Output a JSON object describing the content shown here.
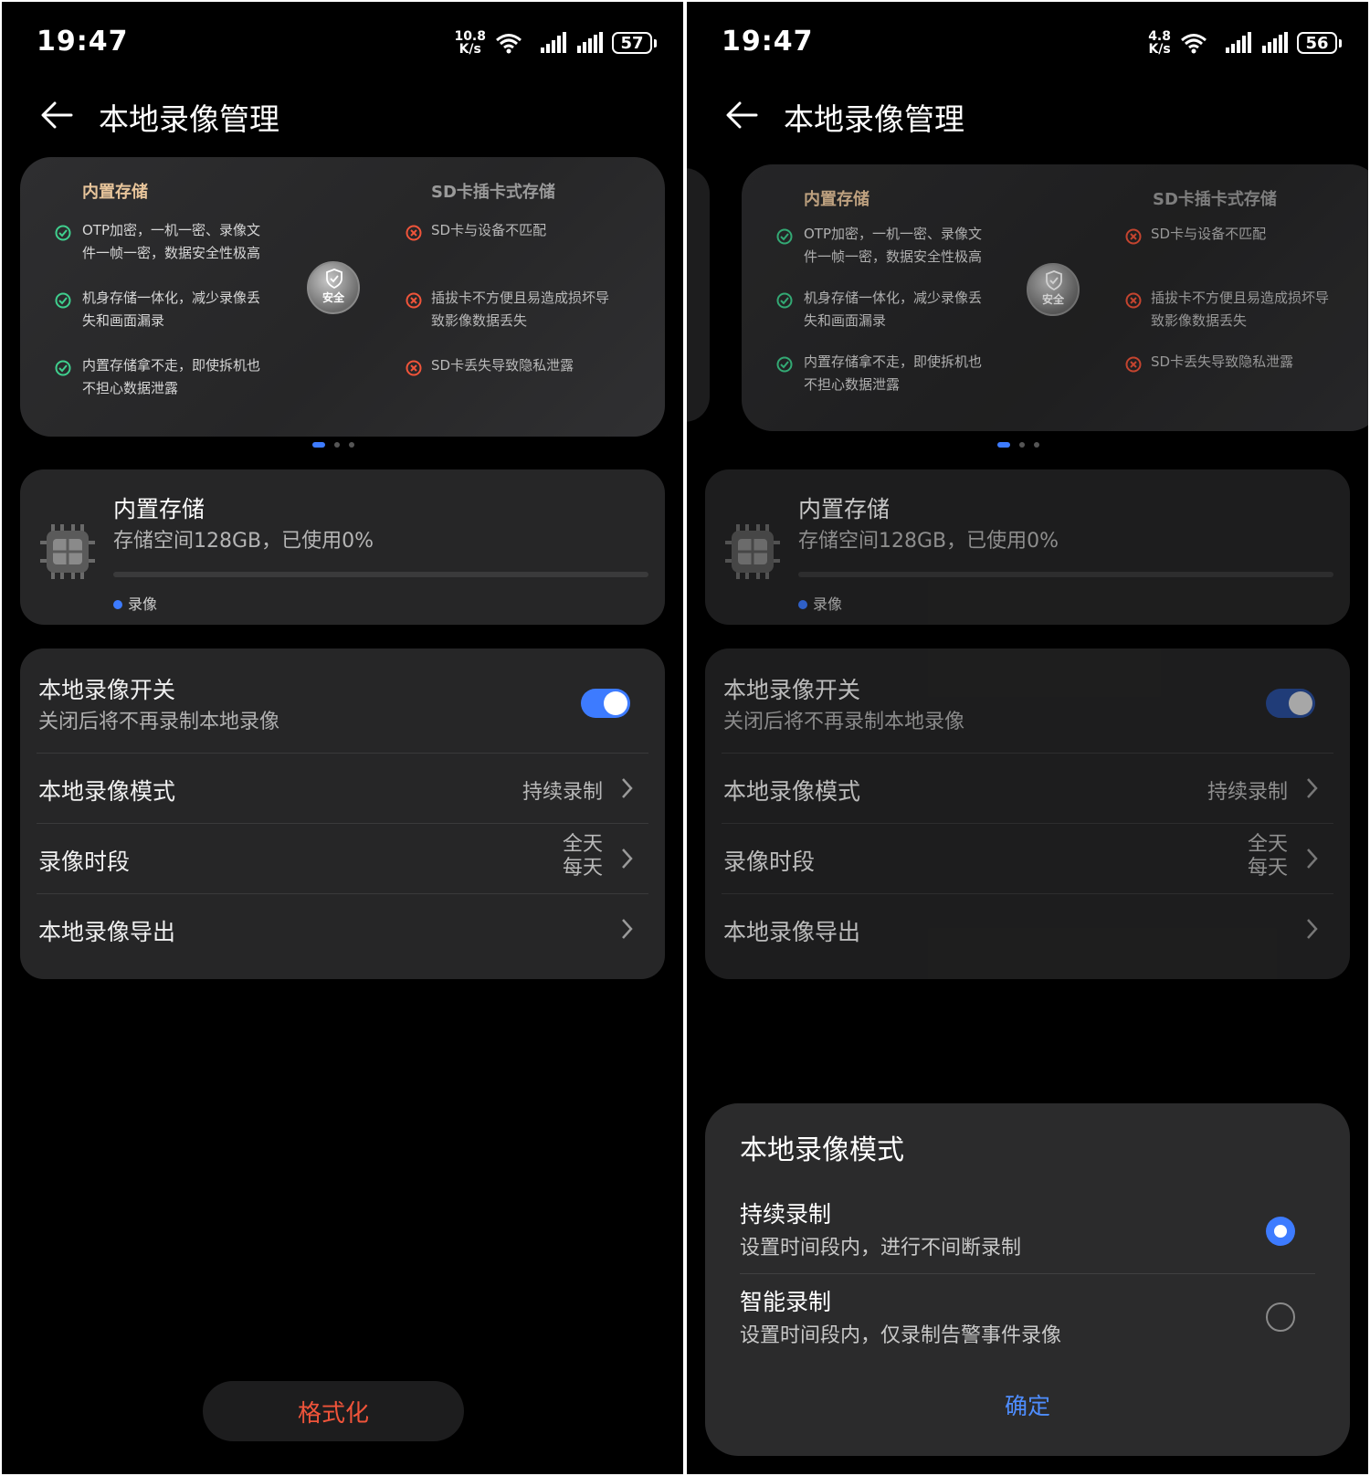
{
  "left": {
    "status": {
      "time": "19:47",
      "net_speed_value": "10.8",
      "net_speed_unit": "K/s",
      "battery": "57"
    },
    "title": "本地录像管理",
    "banner": {
      "left_title": "内置存储",
      "right_title": "SD卡插卡式存储",
      "left_items": [
        "OTP加密，一机一密、录像文件一帧一密，数据安全性极高",
        "机身存储一体化，减少录像丢失和画面漏录",
        "内置存储拿不走，即使拆机也不担心数据泄露"
      ],
      "right_items": [
        "SD卡与设备不匹配",
        "插拔卡不方便且易造成损坏导致影像数据丢失",
        "SD卡丢失导致隐私泄露"
      ],
      "badge": "安全"
    },
    "storage": {
      "title": "内置存储",
      "subtitle": "存储空间128GB，已使用0%",
      "used_fraction": 0,
      "legend": "录像"
    },
    "settings": {
      "switch_title": "本地录像开关",
      "switch_sub": "关闭后将不再录制本地录像",
      "switch_on": true,
      "mode_title": "本地录像模式",
      "mode_value": "持续录制",
      "period_title": "录像时段",
      "period_value_1": "全天",
      "period_value_2": "每天",
      "export_title": "本地录像导出"
    },
    "format_button": "格式化"
  },
  "right": {
    "status": {
      "time": "19:47",
      "net_speed_value": "4.8",
      "net_speed_unit": "K/s",
      "battery": "56"
    },
    "title": "本地录像管理",
    "banner": {
      "left_title": "内置存储",
      "right_title": "SD卡插卡式存储",
      "left_items": [
        "OTP加密，一机一密、录像文件一帧一密，数据安全性极高",
        "机身存储一体化，减少录像丢失和画面漏录",
        "内置存储拿不走，即使拆机也不担心数据泄露"
      ],
      "right_items": [
        "SD卡与设备不匹配",
        "插拔卡不方便且易造成损坏导致影像数据丢失",
        "SD卡丢失导致隐私泄露"
      ],
      "badge": "安全"
    },
    "storage": {
      "title": "内置存储",
      "subtitle": "存储空间128GB，已使用0%",
      "used_fraction": 0,
      "legend": "录像"
    },
    "settings": {
      "switch_title": "本地录像开关",
      "switch_sub": "关闭后将不再录制本地录像",
      "switch_on": true,
      "mode_title": "本地录像模式",
      "mode_value": "持续录制",
      "period_title": "录像时段",
      "period_value_1": "全天",
      "period_value_2": "每天",
      "export_title": "本地录像导出"
    },
    "sheet": {
      "title": "本地录像模式",
      "options": [
        {
          "title": "持续录制",
          "subtitle": "设置时间段内，进行不间断录制",
          "selected": true
        },
        {
          "title": "智能录制",
          "subtitle": "设置时间段内，仅录制告警事件录像",
          "selected": false
        }
      ],
      "confirm": "确定"
    }
  },
  "colors": {
    "accent": "#3d7bff",
    "danger": "#f0543a",
    "ok_green": "#3fcf8e",
    "gold": "#e8c59b",
    "card": "#262627"
  }
}
